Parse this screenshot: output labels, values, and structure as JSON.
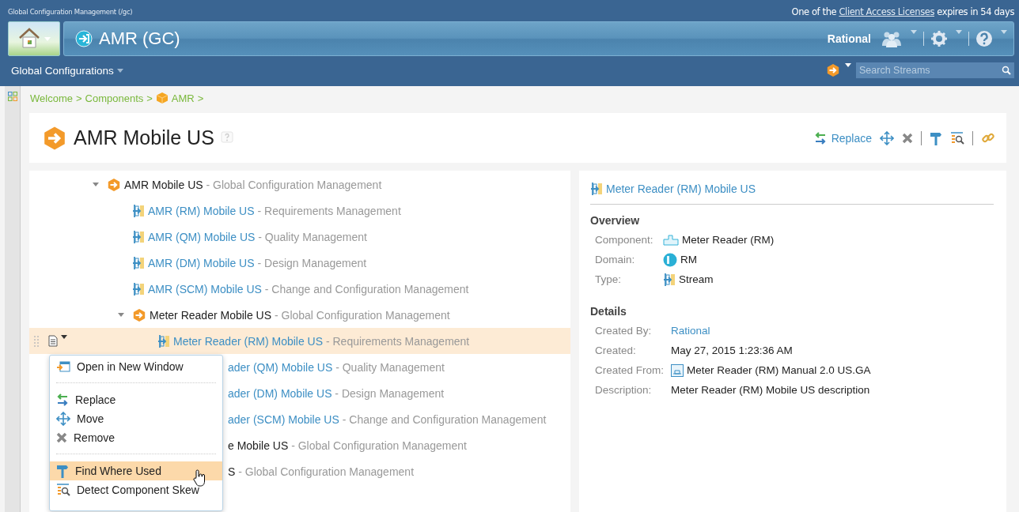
{
  "header": {
    "context": "Global Configuration Management (/gc)",
    "notice_before": "One of the ",
    "notice_link": "Client Access Licenses",
    "notice_after": " expires in 54 days",
    "project": "AMR (GC)",
    "user": "Rational"
  },
  "nav": {
    "menu": "Global Configurations",
    "search": {
      "placeholder": "Search Streams"
    }
  },
  "breadcrumb": {
    "separator": ">",
    "items": [
      {
        "label": "Welcome",
        "kind": "text"
      },
      {
        "label": "Components",
        "kind": "text"
      },
      {
        "label": "AMR",
        "kind": "component"
      }
    ]
  },
  "page": {
    "title": "AMR Mobile US",
    "actions": [
      {
        "kind": "replace",
        "label": "Replace"
      },
      {
        "kind": "move"
      },
      {
        "kind": "remove"
      },
      {
        "kind": "separator"
      },
      {
        "kind": "find"
      },
      {
        "kind": "skew"
      },
      {
        "kind": "separator"
      },
      {
        "kind": "link"
      }
    ]
  },
  "tree": [
    {
      "name": "AMR Mobile US",
      "suffix": " - Global Configuration Management",
      "kind": "configuration",
      "clipped": false,
      "expanded": true,
      "selected": false,
      "children": [
        {
          "name": "AMR (RM) Mobile US",
          "suffix": " - Requirements Management",
          "kind": "stream",
          "clipped": false,
          "selected": false
        },
        {
          "name": "AMR (QM) Mobile US",
          "suffix": " - Quality Management",
          "kind": "stream",
          "clipped": false,
          "selected": false
        },
        {
          "name": "AMR (DM) Mobile US",
          "suffix": " - Design Management",
          "kind": "stream",
          "clipped": false,
          "selected": false
        },
        {
          "name": "AMR (SCM) Mobile US",
          "suffix": " - Change and Configuration Management",
          "kind": "stream",
          "clipped": false,
          "selected": false
        },
        {
          "name": "Meter Reader Mobile US",
          "suffix": " - Global Configuration Management",
          "kind": "configuration",
          "clipped": false,
          "expanded": true,
          "selected": false,
          "children": [
            {
              "name": "Meter Reader (RM) Mobile US",
              "suffix": " - Requirements Management",
              "kind": "stream",
              "clipped": false,
              "selected": true
            },
            {
              "name": "ader (QM) Mobile US",
              "suffix": " - Quality Management",
              "kind": "stream",
              "clipped": true,
              "selected": false
            },
            {
              "name": "ader (DM) Mobile US",
              "suffix": " - Design Management",
              "kind": "stream",
              "clipped": true,
              "selected": false
            },
            {
              "name": "ader (SCM) Mobile US",
              "suffix": " - Change and Configuration Management",
              "kind": "stream",
              "clipped": true,
              "selected": false
            }
          ]
        },
        {
          "name": "e Mobile US",
          "suffix": " - Global Configuration Management",
          "kind": "configuration",
          "clipped": true,
          "expanded": false,
          "selected": false
        },
        {
          "name": "S",
          "suffix": " - Global Configuration Management",
          "kind": "configuration",
          "clipped": true,
          "expanded": false,
          "selected": false
        }
      ]
    }
  ],
  "context_menu": {
    "groups": [
      [
        {
          "kind": "open",
          "label": "Open in New Window",
          "selected": false
        }
      ],
      [
        {
          "kind": "replace",
          "label": "Replace",
          "selected": false
        },
        {
          "kind": "move",
          "label": "Move",
          "selected": false
        },
        {
          "kind": "remove",
          "label": "Remove",
          "selected": false
        }
      ],
      [
        {
          "kind": "find",
          "label": "Find Where Used",
          "selected": true
        },
        {
          "kind": "skew",
          "label": "Detect Component Skew",
          "selected": false
        }
      ]
    ]
  },
  "details": {
    "title": "Meter Reader (RM) Mobile US",
    "sections": [
      {
        "heading": "Overview",
        "rows": [
          {
            "label": "Component:",
            "value": "Meter Reader (RM)",
            "kind": "component"
          },
          {
            "label": "Domain:",
            "value": "RM",
            "kind": "domain"
          },
          {
            "label": "Type:",
            "value": "Stream",
            "kind": "stream"
          }
        ]
      },
      {
        "heading": "Details",
        "rows": [
          {
            "label": "Created By:",
            "value": "Rational",
            "kind": "link"
          },
          {
            "label": "Created:",
            "value": "May 27, 2015 1:23:36 AM",
            "kind": "text"
          },
          {
            "label": "Created From:",
            "value": "Meter Reader (RM) Manual 2.0 US.GA",
            "kind": "baseline"
          },
          {
            "label": "Description:",
            "value": "Meter Reader (RM) Mobile US description",
            "kind": "text"
          }
        ]
      }
    ]
  }
}
